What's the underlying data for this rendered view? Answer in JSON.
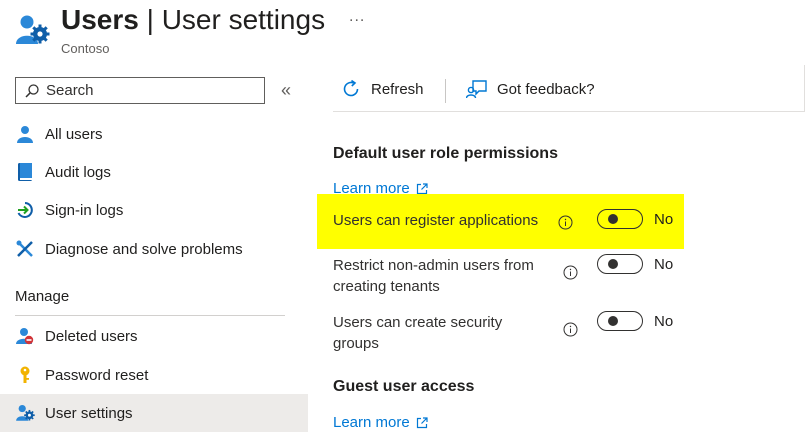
{
  "header": {
    "title_bold": "Users",
    "title_sep": " | ",
    "title_rest": "User settings",
    "more": "...",
    "subtitle": "Contoso"
  },
  "sidebar": {
    "search_placeholder": "Search",
    "collapse": "«",
    "items": [
      {
        "label": "All users",
        "icon": "user-icon"
      },
      {
        "label": "Audit logs",
        "icon": "book-icon"
      },
      {
        "label": "Sign-in logs",
        "icon": "sign-in-icon"
      },
      {
        "label": "Diagnose and solve problems",
        "icon": "wrench-icon"
      }
    ],
    "manage_label": "Manage",
    "manage_items": [
      {
        "label": "Deleted users",
        "icon": "deleted-user-icon"
      },
      {
        "label": "Password reset",
        "icon": "key-icon"
      },
      {
        "label": "User settings",
        "icon": "user-settings-icon",
        "selected": true
      }
    ]
  },
  "toolbar": {
    "refresh": "Refresh",
    "feedback": "Got feedback?"
  },
  "content": {
    "section1_title": "Default user role permissions",
    "learn_more": "Learn more",
    "settings": [
      {
        "label": "Users can register applications",
        "value": "No",
        "on": false
      },
      {
        "label_line1": "Restrict non-admin users from",
        "label_line2": "creating tenants",
        "value": "No",
        "on": false
      },
      {
        "label_line1": "Users can create security",
        "label_line2": "groups",
        "value": "No",
        "on": false
      }
    ],
    "section2_title": "Guest user access",
    "learn_more_2": "Learn more"
  },
  "colors": {
    "accent": "#0078d4",
    "highlight": "#ffff00",
    "selected_bg": "#edebe9"
  }
}
